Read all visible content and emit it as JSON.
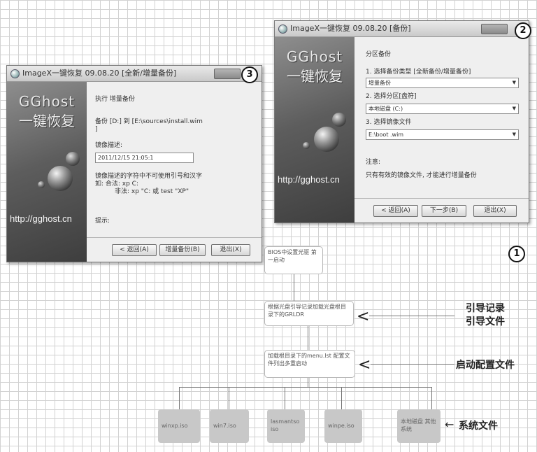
{
  "badges": {
    "diagram": "1",
    "partition_window": "2",
    "execute_window": "3"
  },
  "execute_window": {
    "title": "ImageX一键恢复 09.08.20 [全新/增量备份]",
    "brand_logo": "GGhost",
    "brand_cn": "一键恢复",
    "brand_url": "http://gghost.cn",
    "action_label": "执行 增量备份",
    "backup_line1": "备份 [D:] 到 [E:\\sources\\install.wim",
    "backup_line2": "]",
    "desc_label": "镜像描述:",
    "desc_value": "2011/12/15 21:05:1",
    "hint_line1": "镜像描述的字符中不可使用引号和汉字",
    "hint_line2": "如: 合法:   xp C:",
    "hint_line3": "非法:   xp \"C:  或  test \"XP\"",
    "tip_label": "提示:",
    "back_button": "< 返回(A)",
    "incremental_button": "增量备份(B)",
    "exit_button": "退出(X)"
  },
  "partition_window": {
    "title": "ImageX一键恢复 09.08.20 [备份]",
    "brand_logo": "GGhost",
    "brand_cn": "一键恢复",
    "brand_url": "http://gghost.cn",
    "heading": "分区备份",
    "step1_label": "1. 选择备份类型 [全新备份/增量备份]",
    "step1_value": "增量备份",
    "step2_label": "2. 选择分区[盘符]",
    "step2_value": "本地磁盘 (C:)",
    "step3_label": "3. 选择镜像文件",
    "step3_value": "E:\\boot .wim",
    "note_label": "注意:",
    "note_text": "只有有效的镜像文件, 才能进行增量备份",
    "back_button": "< 返回(A)",
    "next_button": "下一步(B)",
    "exit_button": "退出(X)"
  },
  "flowchart": {
    "step1": "BIOS中设置光驱 第一启动",
    "step2": "根据光盘引导记录加载光盘根目录下的GRLDR",
    "step3": "加载根目录下的menu.lst 配置文件列出多重启动",
    "leaves": [
      "winxp.iso",
      "win7.iso",
      "lasmantso iso",
      "winpe.iso",
      "本地磁盘 其他系统"
    ],
    "label_boot_record": "引导记录",
    "label_boot_file": "引导文件",
    "label_boot_config": "启动配置文件",
    "label_system_files": "系统文件",
    "arrow_glyph": "<",
    "system_arrow": "←"
  }
}
